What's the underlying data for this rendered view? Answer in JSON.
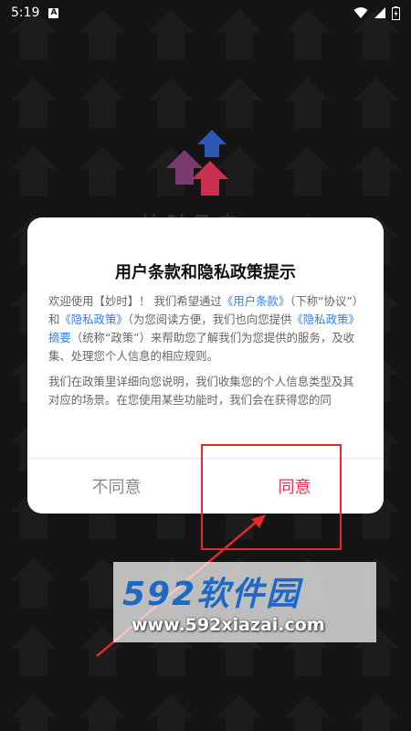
{
  "status_bar": {
    "time": "5:19",
    "notification_icon": "A"
  },
  "app": {
    "title": "妙时日志"
  },
  "dialog": {
    "title": "用户条款和隐私政策提示",
    "para1": {
      "t1": "欢迎使用【妙时】！ 我们希望通过",
      "link1": "《用户条款》",
      "t2": "（下称“协议”）和",
      "link2": "《隐私政策》",
      "t3": "（为您阅读方便，我们也向您提供",
      "link3": "《隐私政策》摘要",
      "t4": "（统称“政策”）来帮助您了解我们为您提供的服务，及收集、处理您个人信息的相应规则。"
    },
    "para2": "我们在政策里详细向您说明，我们收集您的个人信息类型及其对应的场景。在您使用某些功能时，我们会在获得您的同",
    "disagree_label": "不同意",
    "agree_label": "同意"
  },
  "watermark": {
    "brand": "592软件园",
    "url": "www.592xiazai.com"
  },
  "colors": {
    "accent": "#e73255",
    "link": "#3a7fd6",
    "annotation": "#e12a2a",
    "watermark_blue": "#1e68c8"
  }
}
